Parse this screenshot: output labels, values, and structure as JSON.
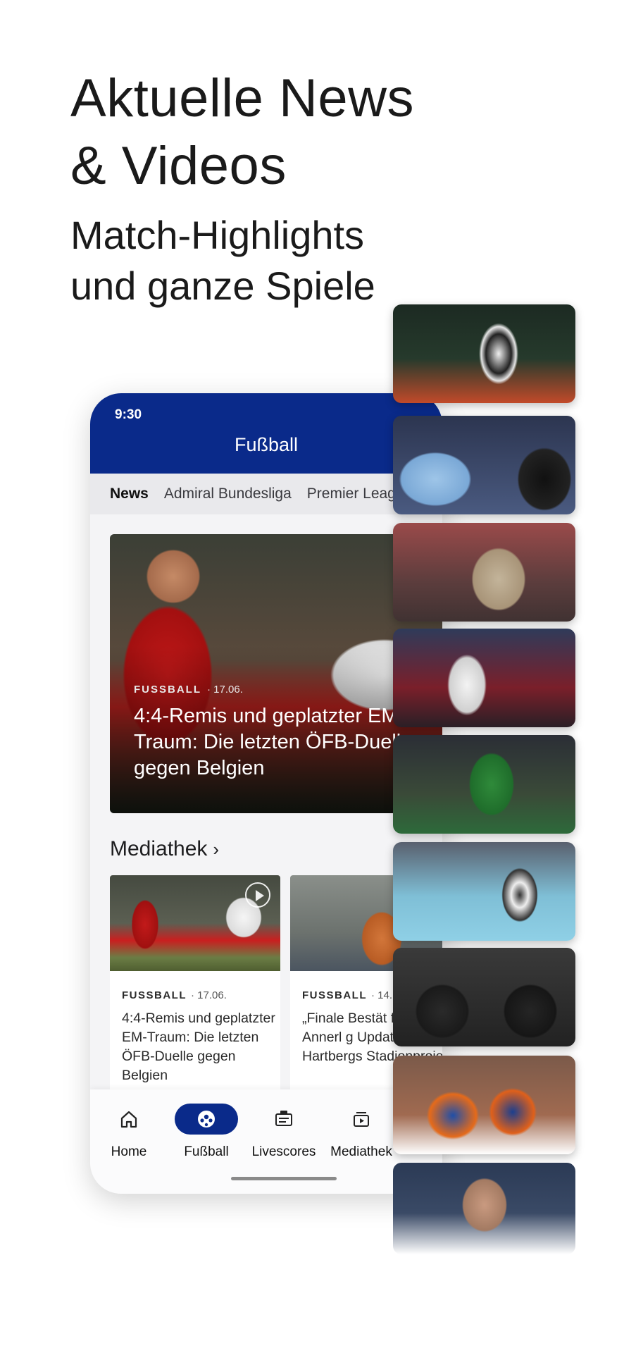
{
  "promo": {
    "headline_line1": "Aktuelle News",
    "headline_line2": "& Videos",
    "subheadline_line1": "Match-Highlights",
    "subheadline_line2": "und ganze Spiele"
  },
  "phone": {
    "status_time": "9:30",
    "app_title": "Fußball",
    "tabs": [
      {
        "label": "News",
        "active": true
      },
      {
        "label": "Admiral Bundesliga",
        "active": false
      },
      {
        "label": "Premier League",
        "active": false
      }
    ],
    "hero": {
      "category": "FUSSBALL",
      "date": "· 17.06.",
      "title": "4:4-Remis und geplatzter EM-Traum: Die letzten ÖFB-Duelle gegen Belgien"
    },
    "mediathek": {
      "title": "Mediathek",
      "chevron": "›",
      "cards": [
        {
          "category": "FUSSBALL",
          "date": "· 17.06.",
          "title": "4:4-Remis und geplatzter EM-Traum: Die letzten ÖFB-Duelle gegen Belgien",
          "has_play_icon": true
        },
        {
          "category": "FUSSBALL",
          "date": "· 14.",
          "title": "„Finale Bestät fehlt: Annerl g Update zu Hartbergs Stadionprojek",
          "has_play_icon": false
        }
      ]
    },
    "bottom_nav": [
      {
        "label": "Home",
        "icon": "home-icon",
        "active": false
      },
      {
        "label": "Fußball",
        "icon": "football-icon",
        "active": true
      },
      {
        "label": "Livescores",
        "icon": "livescores-icon",
        "active": false
      },
      {
        "label": "Mediathek",
        "icon": "mediathek-icon",
        "active": false
      }
    ]
  },
  "thumbnails": [
    {
      "subject": "soccer-player-juventus"
    },
    {
      "subject": "players-arguing-with-referee"
    },
    {
      "subject": "coach-on-sideline"
    },
    {
      "subject": "soccer-player-white-kit"
    },
    {
      "subject": "soccer-duel-green-kit"
    },
    {
      "subject": "tennis-player-serving"
    },
    {
      "subject": "coaches-in-stands"
    },
    {
      "subject": "hockey-players-celebrating"
    },
    {
      "subject": "player-portrait"
    }
  ],
  "colors": {
    "brand_blue": "#0a2a8a",
    "background": "#ffffff",
    "phone_bg": "#f4f4f6"
  }
}
